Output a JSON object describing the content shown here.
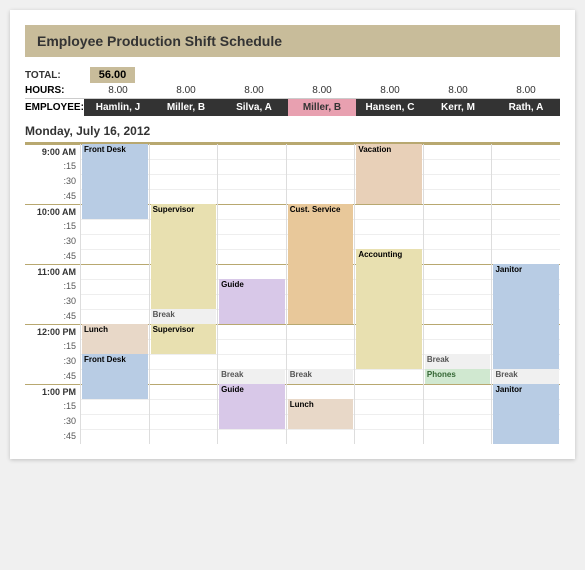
{
  "title": "Employee Production Shift Schedule",
  "totals": {
    "label": "TOTAL:",
    "value": "56.00",
    "hours_label": "HOURS:",
    "employee_label": "EMPLOYEE:"
  },
  "employees": [
    {
      "name": "Hamlin, J",
      "hours": "8.00",
      "highlight": false
    },
    {
      "name": "Miller, B",
      "hours": "8.00",
      "highlight": false
    },
    {
      "name": "Silva, A",
      "hours": "8.00",
      "highlight": false
    },
    {
      "name": "Miller, B",
      "hours": "8.00",
      "highlight": true
    },
    {
      "name": "Hansen, C",
      "hours": "8.00",
      "highlight": false
    },
    {
      "name": "Kerr, M",
      "hours": "8.00",
      "highlight": false
    },
    {
      "name": "Rath, A",
      "hours": "8.00",
      "highlight": false
    }
  ],
  "day": "Monday, July 16, 2012",
  "colors": {
    "front_desk": "#b8cce4",
    "supervisor": "#e8e0b0",
    "guide": "#d8c8e8",
    "cust_service": "#e8c89a",
    "vacation": "#e8d0b8",
    "accounting": "#e8e0b0",
    "janitor": "#b8cce4",
    "lunch": "#e8d8c8",
    "break": "#f0f0f0",
    "phones": "#d0e8d0"
  }
}
